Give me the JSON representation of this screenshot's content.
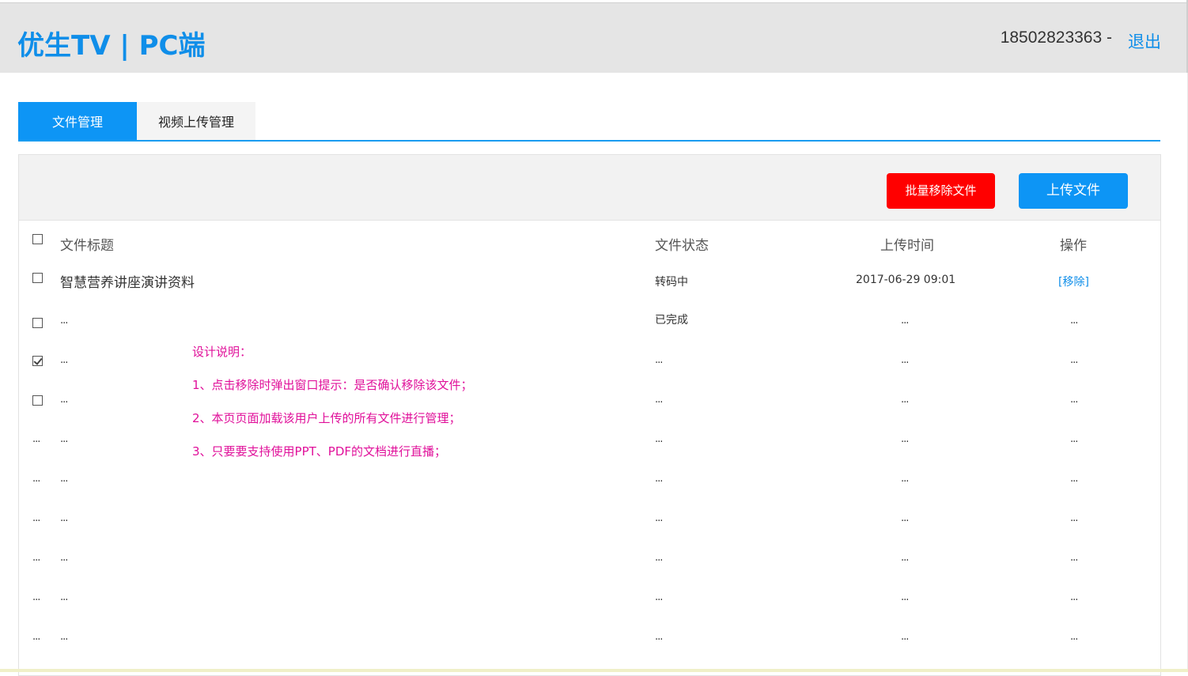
{
  "header": {
    "brand": "优生TV | PC端",
    "user_phone": "18502823363 -",
    "logout": "退出"
  },
  "tabs": [
    {
      "label": "文件管理",
      "active": true
    },
    {
      "label": "视频上传管理",
      "active": false
    }
  ],
  "toolbar": {
    "batch_remove": "批量移除文件",
    "upload": "上传文件"
  },
  "table": {
    "columns": [
      "文件标题",
      "文件状态",
      "上传时间",
      "操作"
    ],
    "rows": [
      {
        "checkbox": "unchecked",
        "title": "智慧营养讲座演讲资料",
        "status": "转码中",
        "time": "2017-06-29 09:01",
        "action": "[移除]"
      },
      {
        "checkbox": "unchecked",
        "title": "...",
        "status": "已完成",
        "time": "...",
        "action": "..."
      },
      {
        "checkbox": "checked",
        "title": "...",
        "status": "...",
        "time": "...",
        "action": "..."
      },
      {
        "checkbox": "unchecked",
        "title": "...",
        "status": "...",
        "time": "...",
        "action": "..."
      },
      {
        "checkbox": "...",
        "title": "...",
        "status": "...",
        "time": "...",
        "action": "..."
      },
      {
        "checkbox": "...",
        "title": "...",
        "status": "...",
        "time": "...",
        "action": "..."
      },
      {
        "checkbox": "...",
        "title": "...",
        "status": "...",
        "time": "...",
        "action": "..."
      },
      {
        "checkbox": "...",
        "title": "...",
        "status": "...",
        "time": "...",
        "action": "..."
      },
      {
        "checkbox": "...",
        "title": "...",
        "status": "...",
        "time": "...",
        "action": "..."
      },
      {
        "checkbox": "...",
        "title": "...",
        "status": "...",
        "time": "...",
        "action": "..."
      }
    ]
  },
  "design_notes": [
    "设计说明：",
    "1、点击移除时弹出窗口提示：是否确认移除该文件；",
    "2、本页页面加载该用户上传的所有文件进行管理；",
    "3、只要要支持使用PPT、PDF的文档进行直播；"
  ],
  "colors": {
    "brand": "#0f8ee9",
    "primary": "#0d95f5",
    "danger": "#ff0000",
    "note": "#e0109a"
  }
}
